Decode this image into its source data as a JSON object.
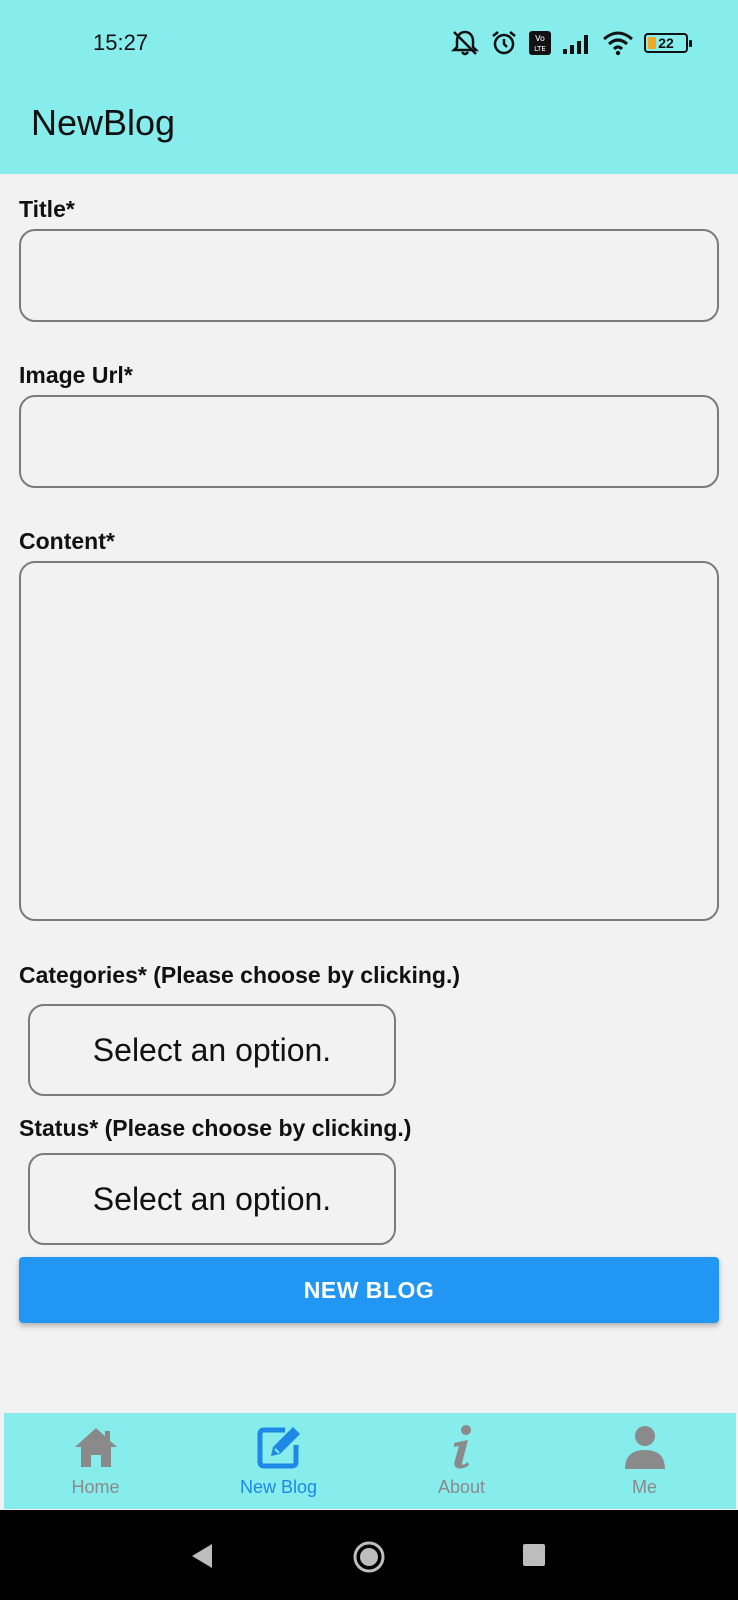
{
  "status_bar": {
    "time": "15:27",
    "battery": "22",
    "icons": [
      "mute-icon",
      "alarm-icon",
      "volte-icon",
      "signal-icon",
      "wifi-icon",
      "battery-icon"
    ]
  },
  "app_bar": {
    "title": "NewBlog"
  },
  "form": {
    "title_label": "Title*",
    "title_value": "",
    "image_url_label": "Image Url*",
    "image_url_value": "",
    "content_label": "Content*",
    "content_value": "",
    "categories_label": "Categories* (Please choose by clicking.)",
    "categories_value": "Select an option.",
    "status_label": "Status* (Please choose by clicking.)",
    "status_value": "Select an option.",
    "submit_label": "NEW BLOG"
  },
  "bottom_nav": {
    "items": [
      {
        "label": "Home",
        "icon": "home-icon",
        "active": false
      },
      {
        "label": "New Blog",
        "icon": "edit-icon",
        "active": true
      },
      {
        "label": "About",
        "icon": "info-icon",
        "active": false
      },
      {
        "label": "Me",
        "icon": "person-icon",
        "active": false
      }
    ]
  },
  "colors": {
    "header": "#87ecec",
    "primary": "#2196f3",
    "active_tab": "#1e88e5",
    "inactive_tab": "#8a8a8a",
    "background": "#f2f2f2"
  }
}
